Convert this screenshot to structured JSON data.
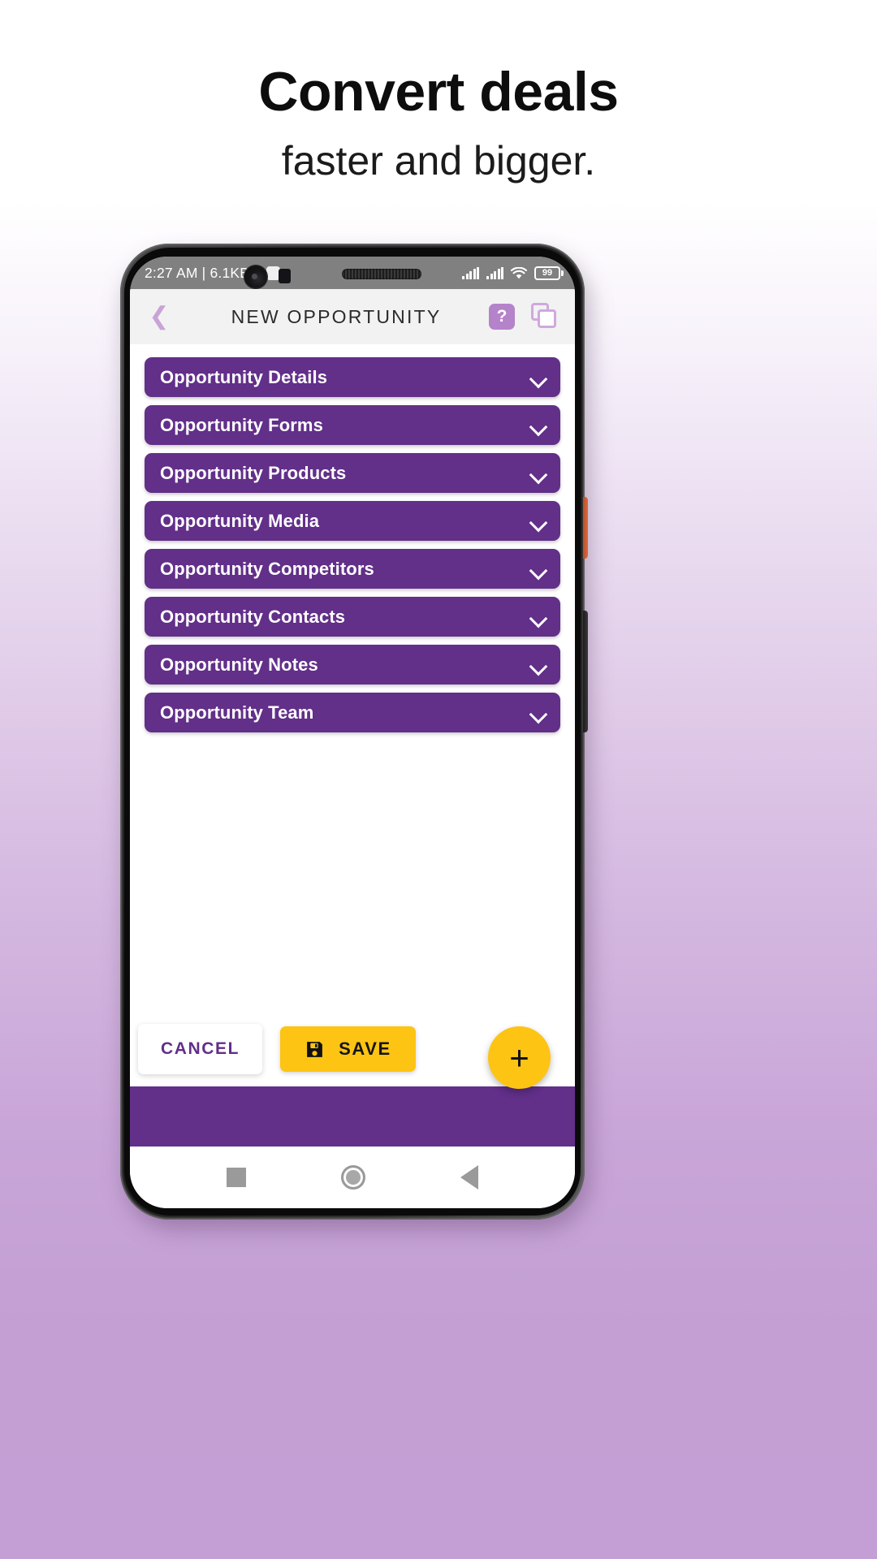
{
  "promo": {
    "title": "Convert deals",
    "subtitle": "faster and bigger."
  },
  "status_bar": {
    "time_and_speed": "2:27 AM | 6.1KB/s",
    "app_icon": "rounded-square-icon",
    "signal_1": "signal-bars-icon",
    "signal_2": "signal-bars-icon",
    "wifi": "wifi-icon",
    "battery_percent": "99"
  },
  "app_bar": {
    "back": "chevron-left-icon",
    "title": "NEW OPPORTUNITY",
    "help_label": "?",
    "copy": "copy-icon"
  },
  "accordion": {
    "items": [
      {
        "label": "Opportunity Details",
        "chevron": "chevron-down-icon"
      },
      {
        "label": "Opportunity Forms",
        "chevron": "chevron-down-icon"
      },
      {
        "label": "Opportunity Products",
        "chevron": "chevron-down-icon"
      },
      {
        "label": "Opportunity Media",
        "chevron": "chevron-down-icon"
      },
      {
        "label": "Opportunity Competitors",
        "chevron": "chevron-down-icon"
      },
      {
        "label": "Opportunity Contacts",
        "chevron": "chevron-down-icon"
      },
      {
        "label": "Opportunity Notes",
        "chevron": "chevron-down-icon"
      },
      {
        "label": "Opportunity Team",
        "chevron": "chevron-down-icon"
      }
    ]
  },
  "actions": {
    "cancel_label": "CANCEL",
    "save_label": "SAVE",
    "save_icon": "floppy-disk-icon",
    "fab_label": "+"
  },
  "nav_bar": {
    "recents": "square-icon",
    "home": "circle-icon",
    "back": "triangle-left-icon"
  },
  "colors": {
    "brand_purple": "#622F89",
    "accent_yellow": "#FDC413",
    "light_purple": "#c9a3d6",
    "help_badge": "#b583c9",
    "status_bar_grey": "#808080"
  }
}
